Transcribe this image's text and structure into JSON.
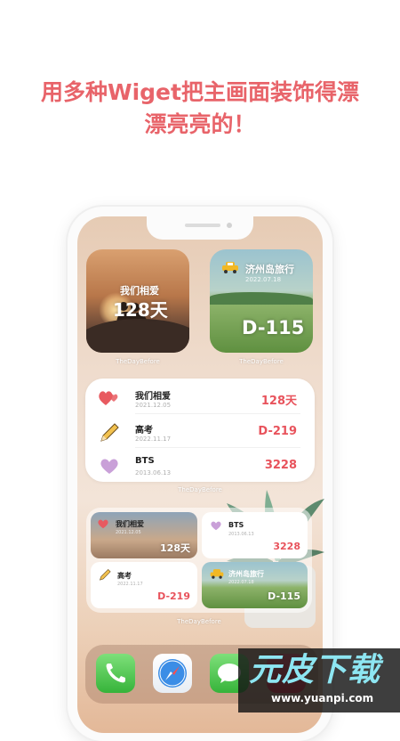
{
  "headline": {
    "line1": "用多种Wiget把主画面装饰得漂",
    "line2": "漂亮亮的！"
  },
  "widgets": {
    "couple": {
      "title": "我们相爱",
      "value": "128天"
    },
    "jeju": {
      "title": "济州岛旅行",
      "date": "2022.07.18",
      "value": "D-115"
    },
    "caption_left": "TheDayBefore",
    "caption_right": "TheDayBefore",
    "list": {
      "rows": [
        {
          "name": "我们相爱",
          "date": "2021.12.05",
          "value": "128天",
          "icon": "hearts-icon"
        },
        {
          "name": "高考",
          "date": "2022.11.17",
          "value": "D-219",
          "icon": "pencil-icon"
        },
        {
          "name": "BTS",
          "date": "2013.06.13",
          "value": "3228",
          "icon": "purple-heart-icon"
        }
      ],
      "caption": "TheDayBefore"
    },
    "grid": {
      "couple": {
        "name": "我们相爱",
        "date": "2021.12.05",
        "value": "128天"
      },
      "bts": {
        "name": "BTS",
        "date": "2013.06.13",
        "value": "3228"
      },
      "exam": {
        "name": "高考",
        "date": "2022.11.17",
        "value": "D-219"
      },
      "jeju": {
        "name": "济州岛旅行",
        "date": "2022.07.18",
        "value": "D-115"
      },
      "caption": "TheDayBefore"
    }
  },
  "dock": [
    "phone-icon",
    "safari-icon",
    "messages-icon",
    "music-icon"
  ],
  "watermark": {
    "main": "元皮下载",
    "url": "www.yuanpi.com"
  },
  "colors": {
    "accent": "#e8535c",
    "headline": "#e8646a"
  }
}
